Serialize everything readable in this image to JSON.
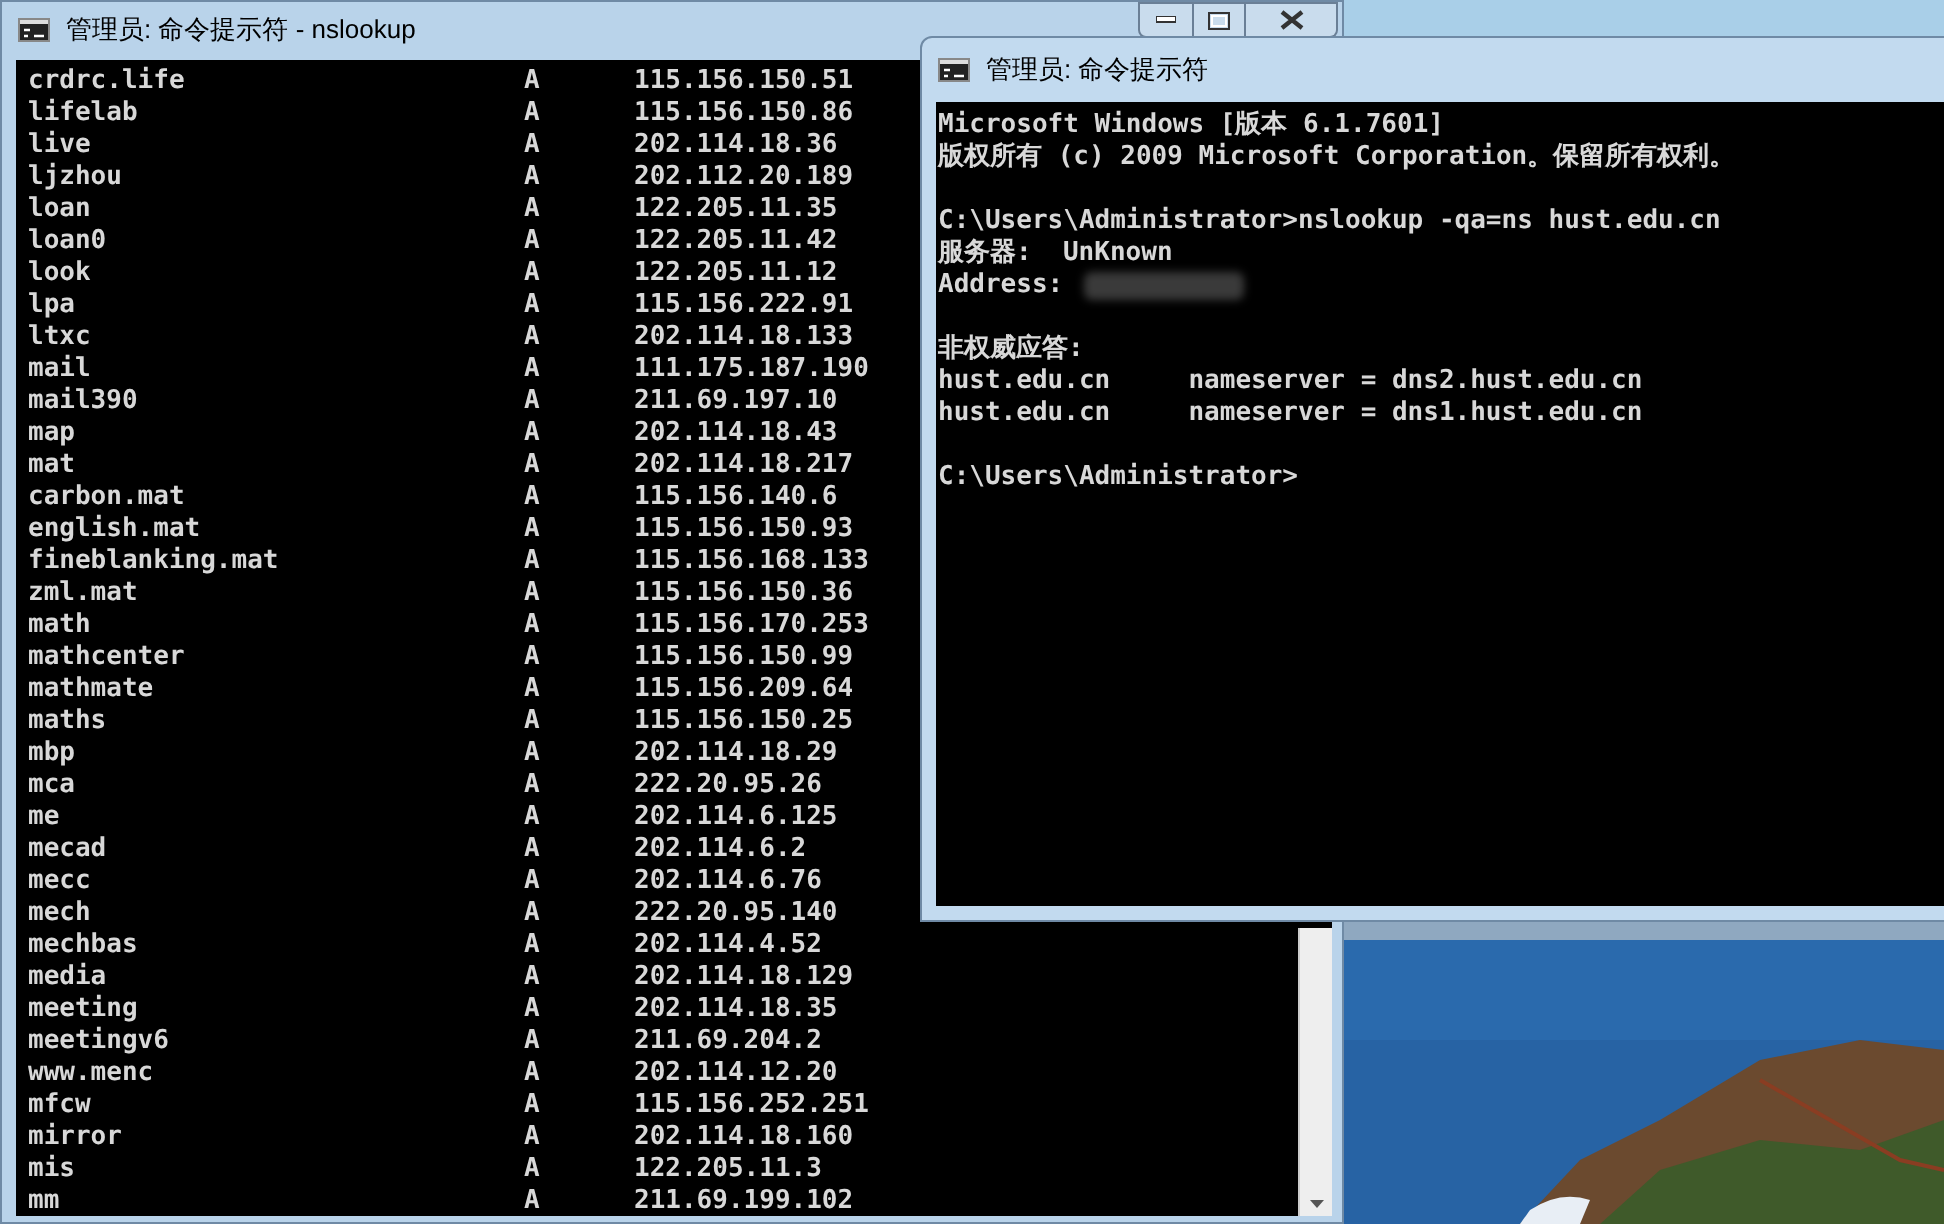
{
  "back_window": {
    "title": "管理员: 命令提示符 - nslookup",
    "records": [
      {
        "name": "crdrc.life",
        "type": "A",
        "address": "115.156.150.51"
      },
      {
        "name": "lifelab",
        "type": "A",
        "address": "115.156.150.86"
      },
      {
        "name": "live",
        "type": "A",
        "address": "202.114.18.36"
      },
      {
        "name": "ljzhou",
        "type": "A",
        "address": "202.112.20.189"
      },
      {
        "name": "loan",
        "type": "A",
        "address": "122.205.11.35"
      },
      {
        "name": "loan0",
        "type": "A",
        "address": "122.205.11.42"
      },
      {
        "name": "look",
        "type": "A",
        "address": "122.205.11.12"
      },
      {
        "name": "lpa",
        "type": "A",
        "address": "115.156.222.91"
      },
      {
        "name": "ltxc",
        "type": "A",
        "address": "202.114.18.133"
      },
      {
        "name": "mail",
        "type": "A",
        "address": "111.175.187.190"
      },
      {
        "name": "mail390",
        "type": "A",
        "address": "211.69.197.10"
      },
      {
        "name": "map",
        "type": "A",
        "address": "202.114.18.43"
      },
      {
        "name": "mat",
        "type": "A",
        "address": "202.114.18.217"
      },
      {
        "name": "carbon.mat",
        "type": "A",
        "address": "115.156.140.6"
      },
      {
        "name": "english.mat",
        "type": "A",
        "address": "115.156.150.93"
      },
      {
        "name": "fineblanking.mat",
        "type": "A",
        "address": "115.156.168.133"
      },
      {
        "name": "zml.mat",
        "type": "A",
        "address": "115.156.150.36"
      },
      {
        "name": "math",
        "type": "A",
        "address": "115.156.170.253"
      },
      {
        "name": "mathcenter",
        "type": "A",
        "address": "115.156.150.99"
      },
      {
        "name": "mathmate",
        "type": "A",
        "address": "115.156.209.64"
      },
      {
        "name": "maths",
        "type": "A",
        "address": "115.156.150.25"
      },
      {
        "name": "mbp",
        "type": "A",
        "address": "202.114.18.29"
      },
      {
        "name": "mca",
        "type": "A",
        "address": "222.20.95.26"
      },
      {
        "name": "me",
        "type": "A",
        "address": "202.114.6.125"
      },
      {
        "name": "mecad",
        "type": "A",
        "address": "202.114.6.2"
      },
      {
        "name": "mecc",
        "type": "A",
        "address": "202.114.6.76"
      },
      {
        "name": "mech",
        "type": "A",
        "address": "222.20.95.140"
      },
      {
        "name": "mechbas",
        "type": "A",
        "address": "202.114.4.52"
      },
      {
        "name": "media",
        "type": "A",
        "address": "202.114.18.129"
      },
      {
        "name": "meeting",
        "type": "A",
        "address": "202.114.18.35"
      },
      {
        "name": "meetingv6",
        "type": "A",
        "address": "211.69.204.2"
      },
      {
        "name": "www.menc",
        "type": "A",
        "address": "202.114.12.20"
      },
      {
        "name": "mfcw",
        "type": "A",
        "address": "115.156.252.251"
      },
      {
        "name": "mirror",
        "type": "A",
        "address": "202.114.18.160"
      },
      {
        "name": "mis",
        "type": "A",
        "address": "122.205.11.3"
      },
      {
        "name": "mm",
        "type": "A",
        "address": "211.69.199.102"
      }
    ]
  },
  "front_window": {
    "title": "管理员: 命令提示符",
    "lines": [
      {
        "kind": "text",
        "text": "Microsoft Windows [版本 6.1.7601]"
      },
      {
        "kind": "text",
        "text": "版权所有 (c) 2009 Microsoft Corporation。保留所有权利。"
      },
      {
        "kind": "blank"
      },
      {
        "kind": "text",
        "text": "C:\\Users\\Administrator>nslookup -qa=ns hust.edu.cn"
      },
      {
        "kind": "text",
        "text": "服务器:  UnKnown"
      },
      {
        "kind": "redacted",
        "text": "Address:"
      },
      {
        "kind": "blank"
      },
      {
        "kind": "text",
        "text": "非权威应答:"
      },
      {
        "kind": "text",
        "text": "hust.edu.cn     nameserver = dns2.hust.edu.cn"
      },
      {
        "kind": "text",
        "text": "hust.edu.cn     nameserver = dns1.hust.edu.cn"
      },
      {
        "kind": "blank"
      },
      {
        "kind": "text",
        "text": "C:\\Users\\Administrator>"
      }
    ]
  }
}
